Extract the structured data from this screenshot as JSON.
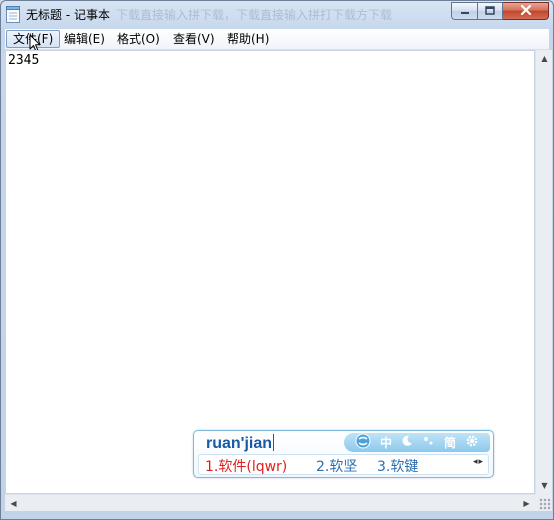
{
  "window": {
    "title": "无标题 - 记事本",
    "ghost_title": "下载直接输入拼下载，下载直接输入拼打下载方下载"
  },
  "menu": {
    "items": [
      {
        "label": "文件(F)"
      },
      {
        "label": "编辑(E)"
      },
      {
        "label": "格式(O)"
      },
      {
        "label": "查看(V)"
      },
      {
        "label": "帮助(H)"
      }
    ]
  },
  "editor": {
    "content": "2345"
  },
  "ime": {
    "composition": "ruan'jian",
    "toolbar": {
      "mode_label": "中",
      "script_label": "简"
    },
    "candidates": [
      {
        "text": "1.软件(lqwr)"
      },
      {
        "text": "2.软坚"
      },
      {
        "text": "3.软键"
      }
    ],
    "accent_color": "#2a6fb4",
    "highlight_color": "#e02020"
  },
  "icons": [
    "notepad-icon",
    "minimize-icon",
    "maximize-icon",
    "close-icon",
    "mouse-cursor-icon",
    "sogou-logo-icon",
    "moon-icon",
    "punctuation-icon",
    "settings-gear-icon",
    "scroll-up-icon",
    "scroll-down-icon",
    "scroll-left-icon",
    "scroll-right-icon",
    "resize-grip-icon"
  ]
}
